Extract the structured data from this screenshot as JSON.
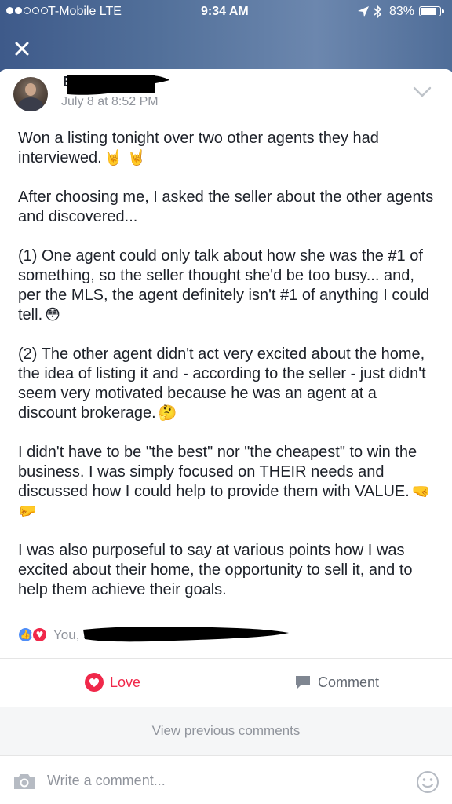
{
  "status_bar": {
    "signal_bars_filled": 2,
    "signal_bars_total": 5,
    "carrier": "T-Mobile  LTE",
    "time": "9:34 AM",
    "battery_text": "83%",
    "battery_level": 0.83,
    "icons": [
      "location-arrow-icon",
      "bluetooth-icon",
      "battery-icon"
    ]
  },
  "header": {
    "close_icon": "close-icon"
  },
  "post": {
    "author_name": "E",
    "timestamp": "July 8 at 8:52 PM",
    "paragraphs": [
      {
        "text": "Won a listing tonight over two other agents they had interviewed.",
        "emoji": "🤘 🤘"
      },
      {
        "text": "After choosing me, I asked the seller about the other agents and discovered...",
        "emoji": ""
      },
      {
        "text": "(1) One agent could only talk about how she was the #1 of something, so the seller thought she'd be too busy... and, per the MLS, the agent definitely isn't #1 of anything I could tell.",
        "emoji": "😳"
      },
      {
        "text": "(2) The other agent didn't act very excited about the home, the idea of listing it and - according to the seller - just didn't seem very motivated because he was an agent at a discount brokerage.",
        "emoji": "🤔"
      },
      {
        "text": "I didn't have to be \"the best\" nor \"the cheapest\" to win the business. I was simply focused on THEIR needs and discussed how I could help to provide them with VALUE.",
        "emoji": "🤜🤛"
      },
      {
        "text": "I was also purposeful to say at various points how I was excited about their home, the opportunity to sell it, and to help them achieve their goals.",
        "emoji": ""
      }
    ],
    "reactions": {
      "types": [
        "like-reaction-icon",
        "love-reaction-icon"
      ],
      "summary": "You, 5 others"
    }
  },
  "actions": {
    "love_label": "Love",
    "comment_label": "Comment",
    "love_color": "#f0284a"
  },
  "comments": {
    "view_previous": "View previous comments",
    "input_placeholder": "Write a comment..."
  }
}
